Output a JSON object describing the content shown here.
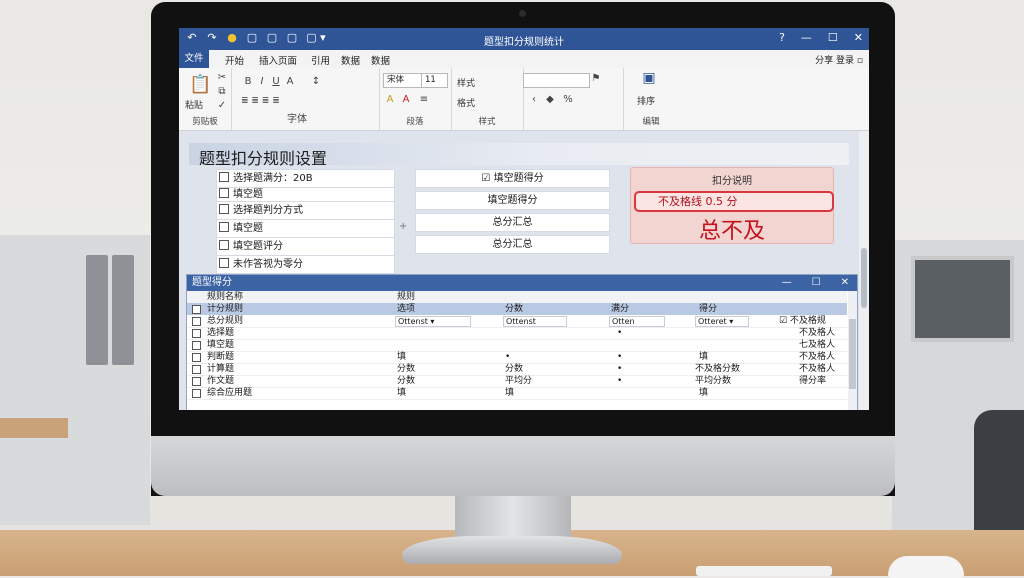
{
  "app": {
    "title": "题型扣分规则统计",
    "quick_access": [
      "↶",
      "↷",
      "●",
      "▢",
      "▢",
      "▢",
      "▢ ▾"
    ],
    "window_controls": [
      "?",
      "—",
      "☐",
      "✕"
    ]
  },
  "tabs": {
    "file": "文件",
    "items": [
      "开始",
      "插入页面",
      "引用",
      "数据",
      "数据"
    ],
    "right": "分享 登录 ▫"
  },
  "ribbon": {
    "groups": [
      {
        "label": "剪贴板",
        "buttons": [
          "粘贴"
        ]
      },
      {
        "label": "字体",
        "buttons": [
          "≣ ≣ ≣ ≣"
        ]
      },
      {
        "label": "段落",
        "buttons": [
          "≡",
          "A",
          "A"
        ]
      },
      {
        "label": "样式",
        "buttons": [
          "样式",
          "格式"
        ]
      },
      {
        "label": "编辑",
        "buttons": [
          "排序"
        ]
      }
    ],
    "font_combo": "宋体",
    "size_combo": "11"
  },
  "settings_panel": {
    "title": "题型扣分规则设置",
    "options": [
      {
        "label": "选择题满分：20B",
        "checked": true
      },
      {
        "label": "填空题",
        "checked": false
      },
      {
        "label": "选择题判分方式",
        "checked": false
      },
      {
        "label": "填空题",
        "checked": false
      },
      {
        "label": "填空题评分",
        "checked": false
      },
      {
        "label": "未作答视为零分",
        "checked": false
      }
    ],
    "middle_boxes": [
      "☑ 填空题得分",
      "填空题得分",
      "总分汇总",
      "总分汇总"
    ],
    "alert": {
      "header": "扣分说明",
      "bar_text": "不及格线 0.5   分",
      "big_text": "总不及"
    }
  },
  "table_window": {
    "title": "题型得分",
    "columns": [
      "规则名称",
      "规则"
    ],
    "selected_row": {
      "name": "计分规则",
      "cols": [
        "选项",
        "分数",
        "满分",
        "得分"
      ]
    },
    "rows": [
      {
        "name": "总分规则",
        "c1": "Ottenst ▾",
        "c2": "Ottenst",
        "c3": "Otten",
        "c4": "Otteret ▾",
        "note": "☑ 不及格规"
      },
      {
        "name": "选择题",
        "c1": "",
        "c2": "",
        "c3": "•",
        "c4": "",
        "note": "不及格人"
      },
      {
        "name": "填空题",
        "c1": "",
        "c2": "",
        "c3": "",
        "c4": "",
        "note": "七及格人"
      },
      {
        "name": "判断题",
        "c1": "填",
        "c2": "•",
        "c3": "•",
        "c4": "填",
        "note": "不及格人"
      },
      {
        "name": "计算题",
        "c1": "分数",
        "c2": "分数",
        "c3": "•",
        "c4": "不及格分数",
        "note": "不及格人"
      },
      {
        "name": "作文题",
        "c1": "分数",
        "c2": "平均分",
        "c3": "•",
        "c4": "平均分数",
        "note": "得分率"
      },
      {
        "name": "综合应用题",
        "c1": "填",
        "c2": "填",
        "c3": "",
        "c4": "填",
        "note": ""
      }
    ]
  }
}
